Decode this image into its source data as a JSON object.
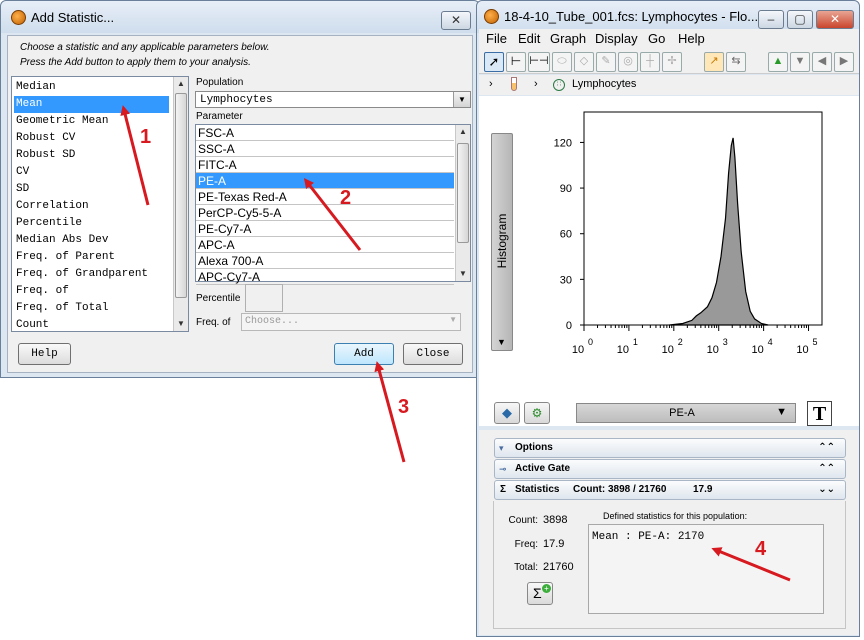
{
  "dialog": {
    "title": "Add Statistic...",
    "close_glyph": "✕",
    "instruction_line1": "Choose a statistic and any applicable parameters below.",
    "instruction_line2": "Press the Add button to apply them to your analysis.",
    "statistics": [
      "Median",
      "Mean",
      "Geometric Mean",
      "Robust CV",
      "Robust SD",
      "CV",
      "SD",
      "Correlation",
      "Percentile",
      "Median Abs Dev",
      "Freq. of Parent",
      "Freq. of Grandparent",
      "Freq. of",
      "Freq. of Total",
      "Count"
    ],
    "selected_statistic_index": 1,
    "population_label": "Population",
    "population_value": "Lymphocytes",
    "parameter_label": "Parameter",
    "parameters": [
      "FSC-A",
      "SSC-A",
      "FITC-A",
      "PE-A",
      "PE-Texas Red-A",
      "PerCP-Cy5-5-A",
      "PE-Cy7-A",
      "APC-A",
      "Alexa 700-A",
      "APC-Cy7-A"
    ],
    "selected_parameter_index": 3,
    "percentile_label": "Percentile",
    "freq_of_label": "Freq. of",
    "freq_of_placeholder": "Choose...",
    "help_label": "Help",
    "add_label": "Add",
    "close_label": "Close"
  },
  "window": {
    "title": "18-4-10_Tube_001.fcs: Lymphocytes - Flo...",
    "menu": [
      "File",
      "Edit",
      "Graph",
      "Display",
      "Go",
      "Help"
    ],
    "breadcrumb_node": "Lymphocytes",
    "side_tab_label": "Histogram",
    "parameter_select": "PE-A",
    "text_tool_glyph": "T",
    "sections": {
      "options": "Options",
      "active_gate": "Active Gate",
      "statistics": "Statistics",
      "statistics_summary": "Count: 3898 / 21760",
      "statistics_freq": "17.9"
    },
    "stats": {
      "count_label": "Count:",
      "count_value": "3898",
      "freq_label": "Freq:",
      "freq_value": "17.9",
      "total_label": "Total:",
      "total_value": "21760",
      "defined_label": "Defined statistics for this population:",
      "defined_value": "Mean : PE-A: 2170"
    },
    "sigma_glyph": "Σ"
  },
  "chart_data": {
    "type": "area",
    "title": "",
    "xlabel": "",
    "ylabel": "",
    "x_scale": "log",
    "x_ticks": [
      "10^0",
      "10^1",
      "10^2",
      "10^3",
      "10^4",
      "10^5"
    ],
    "y_ticks": [
      0,
      30,
      60,
      90,
      120
    ],
    "ylim": [
      0,
      140
    ],
    "xlim_log10": [
      0,
      5.3
    ],
    "x_log10": [
      1.9,
      2.2,
      2.4,
      2.5,
      2.6,
      2.75,
      2.85,
      2.95,
      3.05,
      3.15,
      3.22,
      3.28,
      3.32,
      3.36,
      3.42,
      3.5,
      3.6,
      3.7,
      3.8,
      3.95,
      4.1
    ],
    "y": [
      0,
      1,
      3,
      6,
      8,
      12,
      18,
      28,
      45,
      70,
      100,
      118,
      123,
      110,
      80,
      48,
      22,
      9,
      4,
      1,
      0
    ],
    "fill_color": "#999999"
  },
  "annotations": {
    "markers": [
      "1",
      "2",
      "3",
      "4"
    ],
    "arrow_color": "#d71920"
  }
}
